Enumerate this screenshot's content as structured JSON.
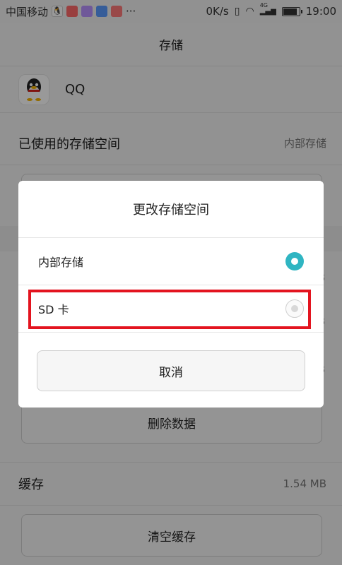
{
  "status_bar": {
    "carrier": "中国移动",
    "more": "···",
    "speed": "0K/s",
    "network": "4G",
    "time": "19:00",
    "app_icon_colors": [
      "#222222",
      "#ff6a6a",
      "#b993ff",
      "#5b9bff",
      "#ff7a7a"
    ]
  },
  "page": {
    "title": "存储",
    "app_name": "QQ"
  },
  "storage_used": {
    "label": "已使用的存储空间",
    "value": "内部存储"
  },
  "background_peeks": [
    "B",
    "B",
    "B"
  ],
  "delete_button": "删除数据",
  "cache": {
    "label": "缓存",
    "value": "1.54 MB"
  },
  "clear_cache_button": "清空缓存",
  "dialog": {
    "title": "更改存储空间",
    "options": [
      {
        "label": "内部存储",
        "selected": true
      },
      {
        "label": "SD 卡",
        "selected": false
      }
    ],
    "cancel": "取消",
    "accent_color": "#2fb5c2",
    "highlight_color": "#e3141f"
  }
}
